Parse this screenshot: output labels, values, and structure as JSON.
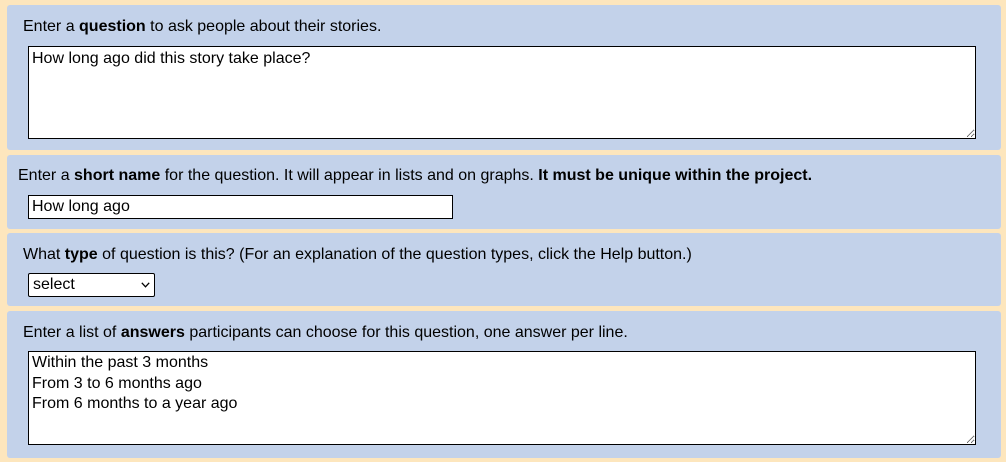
{
  "question": {
    "prompt_pre": "Enter a ",
    "prompt_bold": "question",
    "prompt_post": " to ask people about their stories.",
    "value": "How long ago did this story take place?"
  },
  "short_name": {
    "prompt_pre": "Enter a ",
    "prompt_bold": "short name",
    "prompt_mid": " for the question. It will appear in lists and on graphs. ",
    "prompt_bold2": "It must be unique within the project.",
    "value": "How long ago"
  },
  "type": {
    "prompt_pre": "What ",
    "prompt_bold": "type",
    "prompt_post": " of question is this? (For an explanation of the question types, click the Help button.)",
    "selected": "select",
    "icon": "chevron-down-icon"
  },
  "answers": {
    "prompt_pre": "Enter a list of ",
    "prompt_bold": "answers",
    "prompt_post": " participants can choose for this question, one answer per line.",
    "value": "Within the past 3 months\nFrom 3 to 6 months ago\nFrom 6 months to a year ago"
  },
  "colors": {
    "page_background": "#fde6bd",
    "panel_background": "#c3d2ea"
  }
}
